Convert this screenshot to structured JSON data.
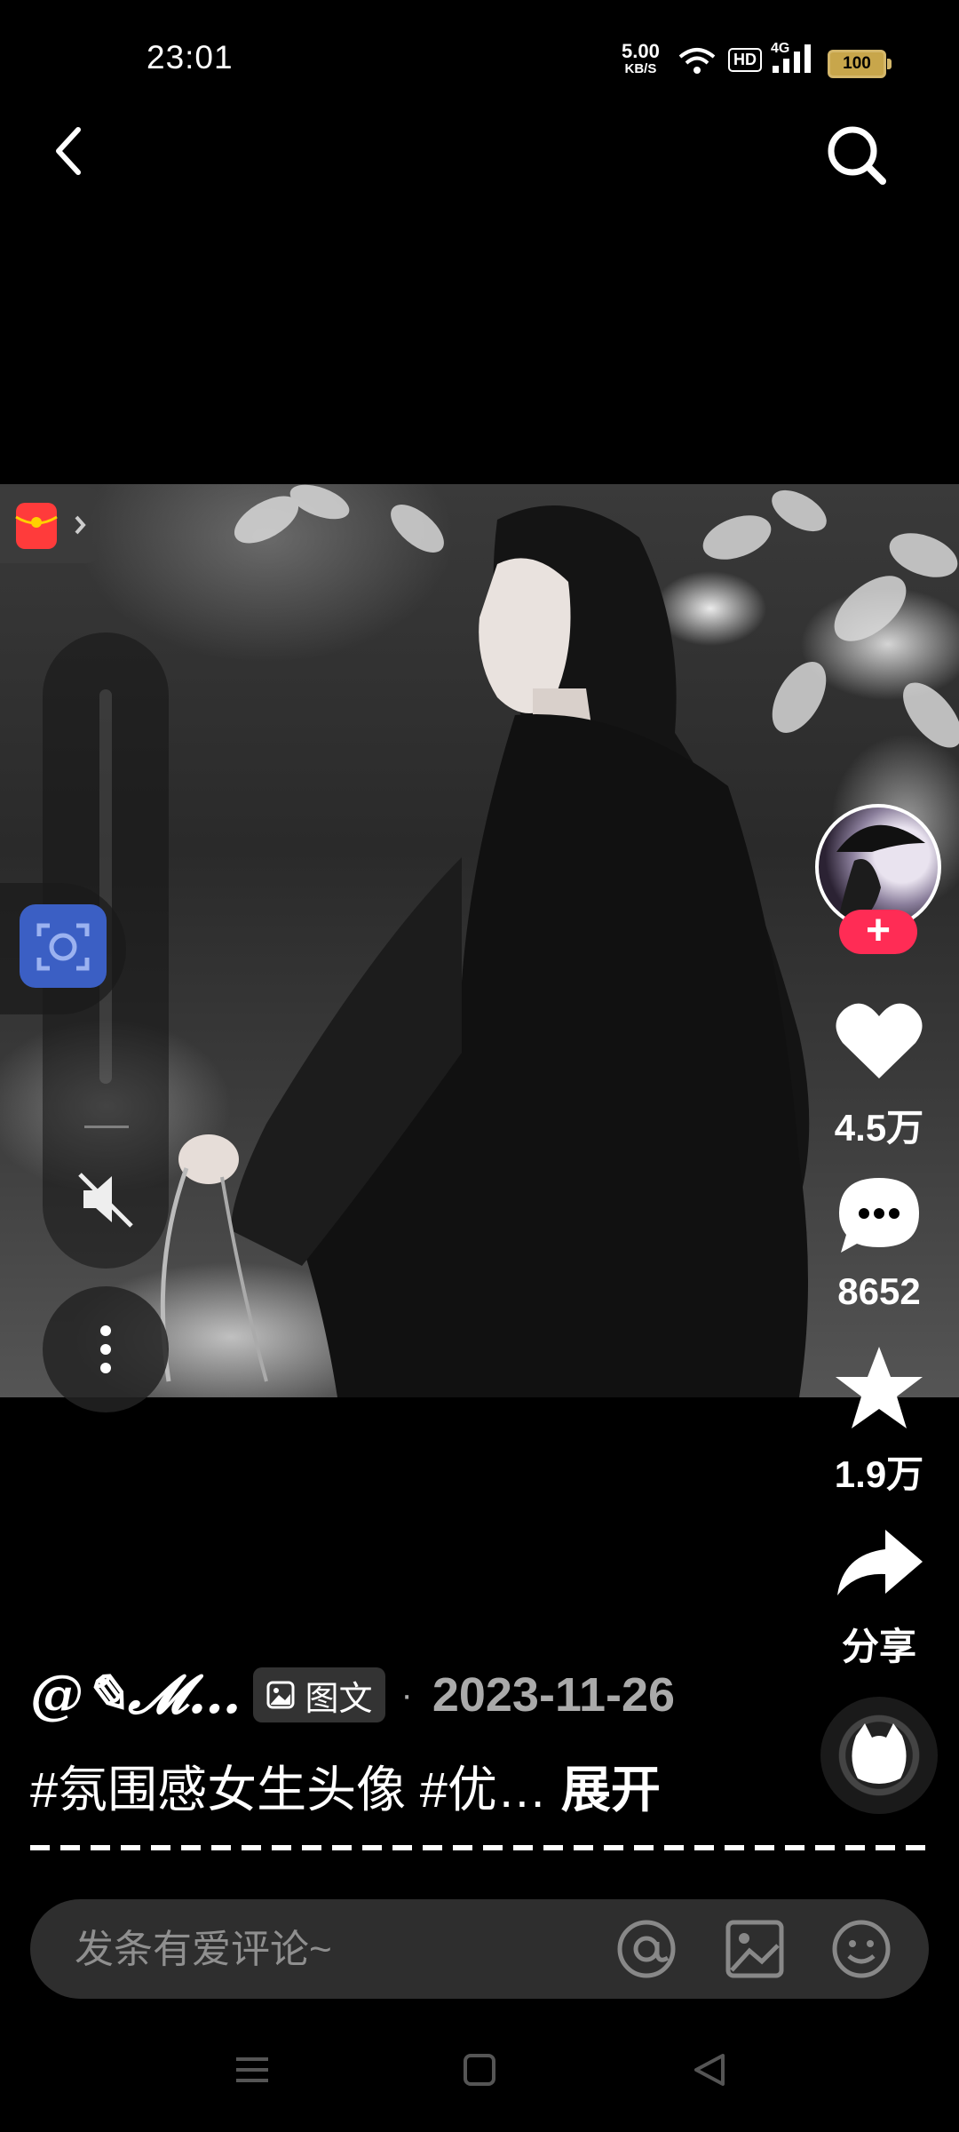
{
  "status_bar": {
    "time": "23:01",
    "net_speed_value": "5.00",
    "net_speed_unit": "KB/S",
    "hd_label": "HD",
    "network_label": "4G",
    "battery_level": "100"
  },
  "media": {
    "content_kind": "photo",
    "icons": [
      "red-packet-icon",
      "screenshot-icon",
      "mute-icon",
      "more-icon"
    ]
  },
  "actions": {
    "like_count": "4.5万",
    "comment_count": "8652",
    "favorite_count": "1.9万",
    "share_label": "分享",
    "follow_label": "+"
  },
  "post": {
    "author": "@✎𝓜…",
    "content_type": "图文",
    "separator": "·",
    "date": "2023-11-26",
    "caption": "#氛围感女生头像 #优…",
    "expand_label": "展开"
  },
  "comment_bar": {
    "placeholder": "发条有爱评论~",
    "icons": [
      "at-icon",
      "image-icon",
      "emoji-icon"
    ]
  },
  "system_nav": [
    "menu",
    "home",
    "back"
  ],
  "colors": {
    "accent": "#ff2c55",
    "screenshot_button": "#3b5fc4",
    "background": "#000000"
  }
}
